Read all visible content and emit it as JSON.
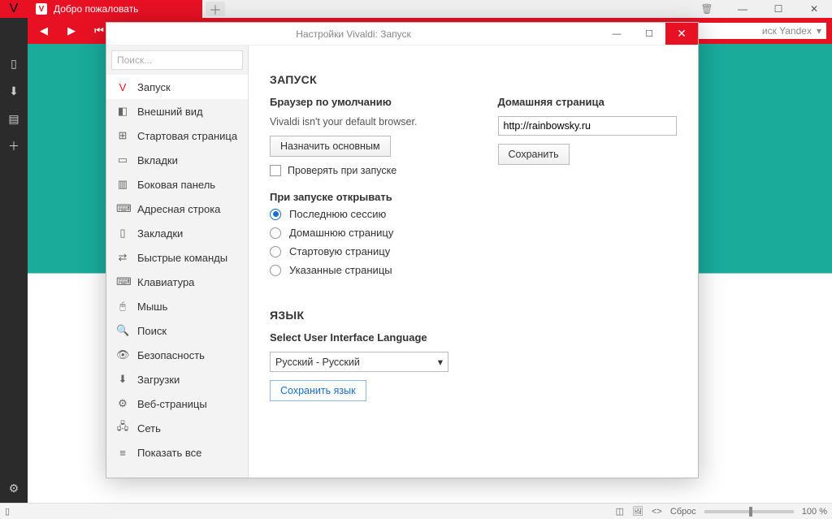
{
  "browser": {
    "tab_title": "Добро пожаловать",
    "search_placeholder": "иск Yandex"
  },
  "statusbar": {
    "reset": "Сброс",
    "zoom": "100 %"
  },
  "settings": {
    "window_title": "Настройки Vivaldi: Запуск",
    "search_placeholder": "Поиск...",
    "sidebar": [
      {
        "icon": "V",
        "label": "Запуск",
        "active": true
      },
      {
        "icon": "◧",
        "label": "Внешний вид"
      },
      {
        "icon": "⊞",
        "label": "Стартовая страница"
      },
      {
        "icon": "▭",
        "label": "Вкладки"
      },
      {
        "icon": "▥",
        "label": "Боковая панель"
      },
      {
        "icon": "⌨",
        "label": "Адресная строка"
      },
      {
        "icon": "▯",
        "label": "Закладки"
      },
      {
        "icon": "⇄",
        "label": "Быстрые команды"
      },
      {
        "icon": "⌨",
        "label": "Клавиатура"
      },
      {
        "icon": "🖰",
        "label": "Мышь"
      },
      {
        "icon": "🔍",
        "label": "Поиск"
      },
      {
        "icon": "👁",
        "label": "Безопасность"
      },
      {
        "icon": "⬇",
        "label": "Загрузки"
      },
      {
        "icon": "⚙",
        "label": "Веб-страницы"
      },
      {
        "icon": "🖧",
        "label": "Сеть"
      },
      {
        "icon": "≡",
        "label": "Показать все"
      }
    ],
    "section_startup": "ЗАПУСК",
    "default_browser_label": "Браузер по умолчанию",
    "default_browser_msg": "Vivaldi isn't your default browser.",
    "set_default_btn": "Назначить основным",
    "check_on_start": "Проверять при запуске",
    "homepage_label": "Домашняя страница",
    "homepage_value": "http://rainbowsky.ru",
    "save_btn": "Сохранить",
    "on_start_label": "При запуске открывать",
    "radios": [
      "Последнюю сессию",
      "Домашнюю страницу",
      "Стартовую страницу",
      "Указанные страницы"
    ],
    "radio_selected": 0,
    "section_lang": "ЯЗЫК",
    "lang_select_label": "Select User Interface Language",
    "lang_value": "Русский - Русский",
    "save_lang_btn": "Сохранить язык"
  }
}
